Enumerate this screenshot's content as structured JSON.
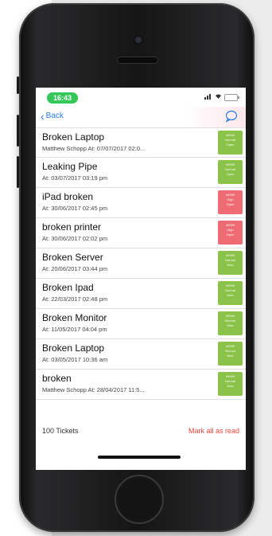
{
  "status": {
    "time": "16:43"
  },
  "nav": {
    "back_label": "Back"
  },
  "tickets": [
    {
      "title": "Broken Laptop",
      "subtitle": "Matthew Schopp  At: 07/07/2017  02:0...",
      "badge": [
        "#9999",
        "Normal",
        "Open"
      ],
      "color": "#8bc34a"
    },
    {
      "title": "Leaking Pipe",
      "subtitle": "At: 03/07/2017  03:19 pm",
      "badge": [
        "#9999",
        "Normal",
        "Open"
      ],
      "color": "#8bc34a"
    },
    {
      "title": "iPad broken",
      "subtitle": "At: 30/06/2017  02:45 pm",
      "badge": [
        "#9999",
        "High",
        "Open"
      ],
      "color": "#ef6b73"
    },
    {
      "title": "broken printer",
      "subtitle": "At: 30/06/2017  02:02 pm",
      "badge": [
        "#9999",
        "High",
        "Open"
      ],
      "color": "#ef6b73"
    },
    {
      "title": "Broken Server",
      "subtitle": "At: 20/06/2017  03:44 pm",
      "badge": [
        "#9999",
        "Normal",
        "New"
      ],
      "color": "#8bc34a"
    },
    {
      "title": "Broken Ipad",
      "subtitle": "At: 22/03/2017  02:48 pm",
      "badge": [
        "#9999",
        "Normal",
        "New"
      ],
      "color": "#8bc34a"
    },
    {
      "title": "Broken Monitor",
      "subtitle": "At: 11/05/2017  04:04 pm",
      "badge": [
        "#9999",
        "Normal",
        "New"
      ],
      "color": "#8bc34a"
    },
    {
      "title": "Broken Laptop",
      "subtitle": "At: 03/05/2017  10:36 am",
      "badge": [
        "#9999",
        "Normal",
        "New"
      ],
      "color": "#8bc34a"
    },
    {
      "title": "broken",
      "subtitle": "Matthew Schopp  At: 28/04/2017  11:5...",
      "badge": [
        "#9999",
        "Normal",
        "New"
      ],
      "color": "#8bc34a"
    }
  ],
  "footer": {
    "count_label": "100 Tickets",
    "mark_read_label": "Mark all as read"
  },
  "colors": {
    "accent": "#2a7ae2",
    "status_green": "#34c759",
    "mark_read": "#e8443a",
    "normal_badge": "#8bc34a",
    "high_badge": "#ef6b73"
  },
  "icons": {
    "back": "chevron-left-icon",
    "chat": "chat-bubble-icon",
    "signal": "signal-icon",
    "wifi": "wifi-icon",
    "battery": "battery-icon"
  }
}
